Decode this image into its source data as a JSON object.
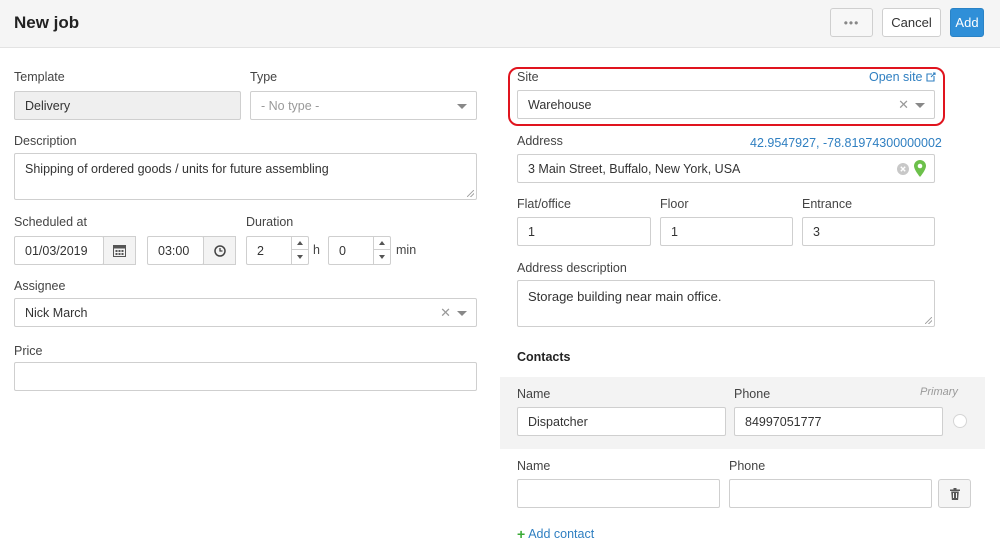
{
  "header": {
    "title": "New job",
    "more_label": "•••",
    "cancel_label": "Cancel",
    "add_label": "Add"
  },
  "left": {
    "template": {
      "label": "Template",
      "value": "Delivery"
    },
    "type": {
      "label": "Type",
      "placeholder": "- No type -"
    },
    "description": {
      "label": "Description",
      "value": "Shipping of ordered goods / units for future assembling"
    },
    "scheduled": {
      "label": "Scheduled at",
      "date": "01/03/2019",
      "time": "03:00"
    },
    "duration": {
      "label": "Duration",
      "hours": "2",
      "hours_unit": "h",
      "minutes": "0",
      "minutes_unit": "min"
    },
    "assignee": {
      "label": "Assignee",
      "value": "Nick March"
    },
    "price": {
      "label": "Price",
      "value": ""
    }
  },
  "right": {
    "site": {
      "label": "Site",
      "open_link": "Open site",
      "value": "Warehouse"
    },
    "address": {
      "label": "Address",
      "coords": "42.9547927, -78.81974300000002",
      "value": "3 Main Street, Buffalo, New York, USA"
    },
    "flat": {
      "label": "Flat/office",
      "value": "1"
    },
    "floor": {
      "label": "Floor",
      "value": "1"
    },
    "entrance": {
      "label": "Entrance",
      "value": "3"
    },
    "address_description": {
      "label": "Address description",
      "value": "Storage building near main office."
    },
    "contacts": {
      "title": "Contacts",
      "primary_label": "Primary",
      "name_label": "Name",
      "phone_label": "Phone",
      "rows": [
        {
          "name": "Dispatcher",
          "phone": "84997051777"
        },
        {
          "name": "",
          "phone": ""
        }
      ],
      "add_label": "Add contact"
    }
  },
  "colors": {
    "accent": "#2f8fd8",
    "link": "#2f7fc1",
    "highlight": "#e0141e",
    "pin": "#6cc04a"
  }
}
